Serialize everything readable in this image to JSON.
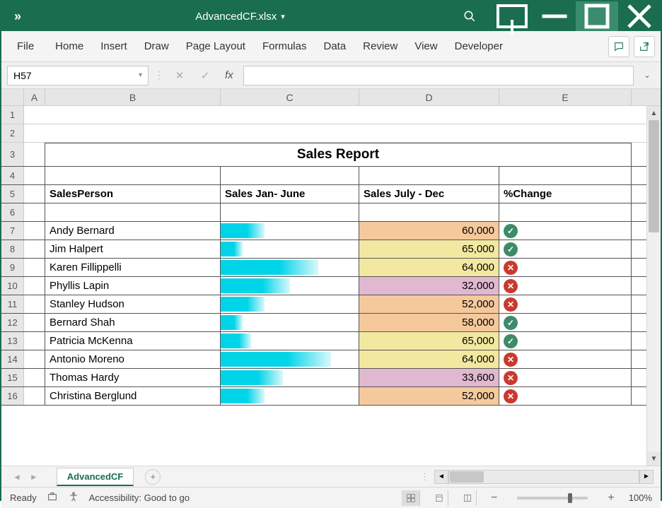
{
  "titlebar": {
    "filename": "AdvancedCF.xlsx"
  },
  "ribbon": {
    "tabs": [
      "File",
      "Home",
      "Insert",
      "Draw",
      "Page Layout",
      "Formulas",
      "Data",
      "Review",
      "View",
      "Developer"
    ]
  },
  "fbar": {
    "namebox": "H57",
    "fx_label": "fx"
  },
  "columns": [
    "A",
    "B",
    "C",
    "D",
    "E"
  ],
  "sheet": {
    "title": "Sales Report",
    "headers": {
      "b": "SalesPerson",
      "c": "Sales Jan- June",
      "d": "Sales July - Dec",
      "e": "%Change"
    },
    "rows": [
      {
        "rn": 7,
        "name": "Andy Bernard",
        "bar_pct": 32,
        "d": "60,000",
        "dcolor": "orange",
        "chg": "ok"
      },
      {
        "rn": 8,
        "name": "Jim Halpert",
        "bar_pct": 16,
        "d": "65,000",
        "dcolor": "yellow",
        "chg": "ok"
      },
      {
        "rn": 9,
        "name": "Karen Fillippelli",
        "bar_pct": 71,
        "d": "64,000",
        "dcolor": "yellow",
        "chg": "bad"
      },
      {
        "rn": 10,
        "name": "Phyllis Lapin",
        "bar_pct": 50,
        "d": "32,000",
        "dcolor": "pink",
        "chg": "bad"
      },
      {
        "rn": 11,
        "name": "Stanley Hudson",
        "bar_pct": 32,
        "d": "52,000",
        "dcolor": "orange",
        "chg": "bad"
      },
      {
        "rn": 12,
        "name": "Bernard Shah",
        "bar_pct": 16,
        "d": "58,000",
        "dcolor": "orange",
        "chg": "ok"
      },
      {
        "rn": 13,
        "name": "Patricia McKenna",
        "bar_pct": 22,
        "d": "65,000",
        "dcolor": "yellow",
        "chg": "ok"
      },
      {
        "rn": 14,
        "name": "Antonio Moreno",
        "bar_pct": 80,
        "d": "64,000",
        "dcolor": "yellow",
        "chg": "bad"
      },
      {
        "rn": 15,
        "name": "Thomas Hardy",
        "bar_pct": 45,
        "d": "33,600",
        "dcolor": "pink",
        "chg": "bad"
      },
      {
        "rn": 16,
        "name": "Christina Berglund",
        "bar_pct": 32,
        "d": "52,000",
        "dcolor": "orange",
        "chg": "bad"
      }
    ]
  },
  "sheetbar": {
    "tab": "AdvancedCF"
  },
  "status": {
    "ready": "Ready",
    "accessibility": "Accessibility: Good to go",
    "zoom": "100%"
  }
}
